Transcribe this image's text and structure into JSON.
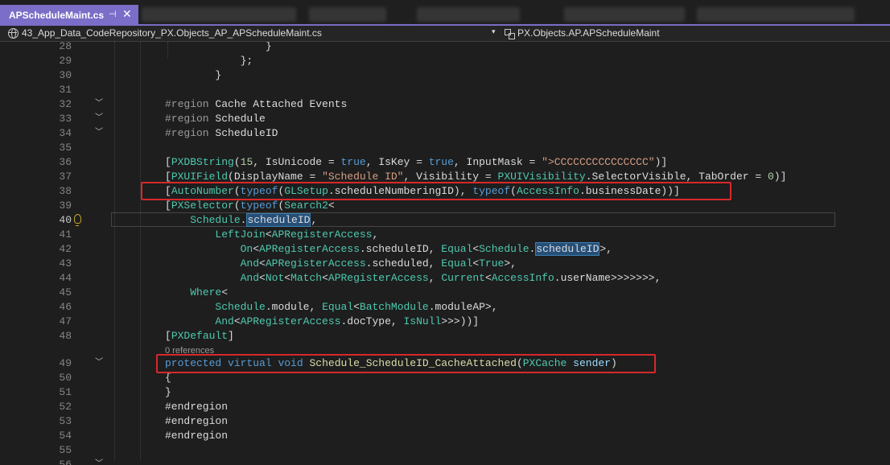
{
  "tabs": {
    "active": {
      "label": "APScheduleMaint.cs",
      "pin_glyph": "⊣",
      "close_glyph": "✕"
    }
  },
  "nav": {
    "project": "43_App_Data_CodeRepository_PX.Objects_AP_APScheduleMaint.cs",
    "member": "PX.Objects.AP.APScheduleMaint",
    "dropdown_glyph": "▾"
  },
  "code": {
    "lines": [
      {
        "n": "28",
        "t": "                }"
      },
      {
        "n": "29",
        "t": "            };"
      },
      {
        "n": "30",
        "t": "        }"
      },
      {
        "n": "31",
        "t": ""
      },
      {
        "n": "32",
        "t": "        #region Cache Attached Events"
      },
      {
        "n": "33",
        "t": "        #region Schedule"
      },
      {
        "n": "34",
        "t": "        #region ScheduleID"
      },
      {
        "n": "35",
        "t": ""
      },
      {
        "n": "36",
        "t": "        [PXDBString(15, IsUnicode = true, IsKey = true, InputMask = \">CCCCCCCCCCCCCCC\")]"
      },
      {
        "n": "37",
        "t": "        [PXUIField(DisplayName = \"Schedule ID\", Visibility = PXUIVisibility.SelectorVisible, TabOrder = 0)]"
      },
      {
        "n": "38",
        "t": "        [AutoNumber(typeof(GLSetup.scheduleNumberingID), typeof(AccessInfo.businessDate))]"
      },
      {
        "n": "39",
        "t": "        [PXSelector(typeof(Search2<"
      },
      {
        "n": "40",
        "t": "            Schedule.scheduleID,"
      },
      {
        "n": "41",
        "t": "                LeftJoin<APRegisterAccess,"
      },
      {
        "n": "42",
        "t": "                    On<APRegisterAccess.scheduleID, Equal<Schedule.scheduleID>,"
      },
      {
        "n": "43",
        "t": "                    And<APRegisterAccess.scheduled, Equal<True>,"
      },
      {
        "n": "44",
        "t": "                    And<Not<Match<APRegisterAccess, Current<AccessInfo.userName>>>>>>>,"
      },
      {
        "n": "45",
        "t": "            Where<"
      },
      {
        "n": "46",
        "t": "                Schedule.module, Equal<BatchModule.moduleAP>,"
      },
      {
        "n": "47",
        "t": "                And<APRegisterAccess.docType, IsNull>>>))]"
      },
      {
        "n": "48",
        "t": "        [PXDefault]"
      },
      {
        "n": "49",
        "t": "        protected virtual void Schedule_ScheduleID_CacheAttached(PXCache sender)"
      },
      {
        "n": "50",
        "t": "        {"
      },
      {
        "n": "51",
        "t": "        }"
      },
      {
        "n": "52",
        "t": "        #endregion"
      },
      {
        "n": "53",
        "t": "        #endregion"
      },
      {
        "n": "54",
        "t": "        #endregion"
      },
      {
        "n": "55",
        "t": ""
      },
      {
        "n": "56",
        "t": ""
      }
    ],
    "codelens_references": "0 references",
    "current_line": "40"
  }
}
